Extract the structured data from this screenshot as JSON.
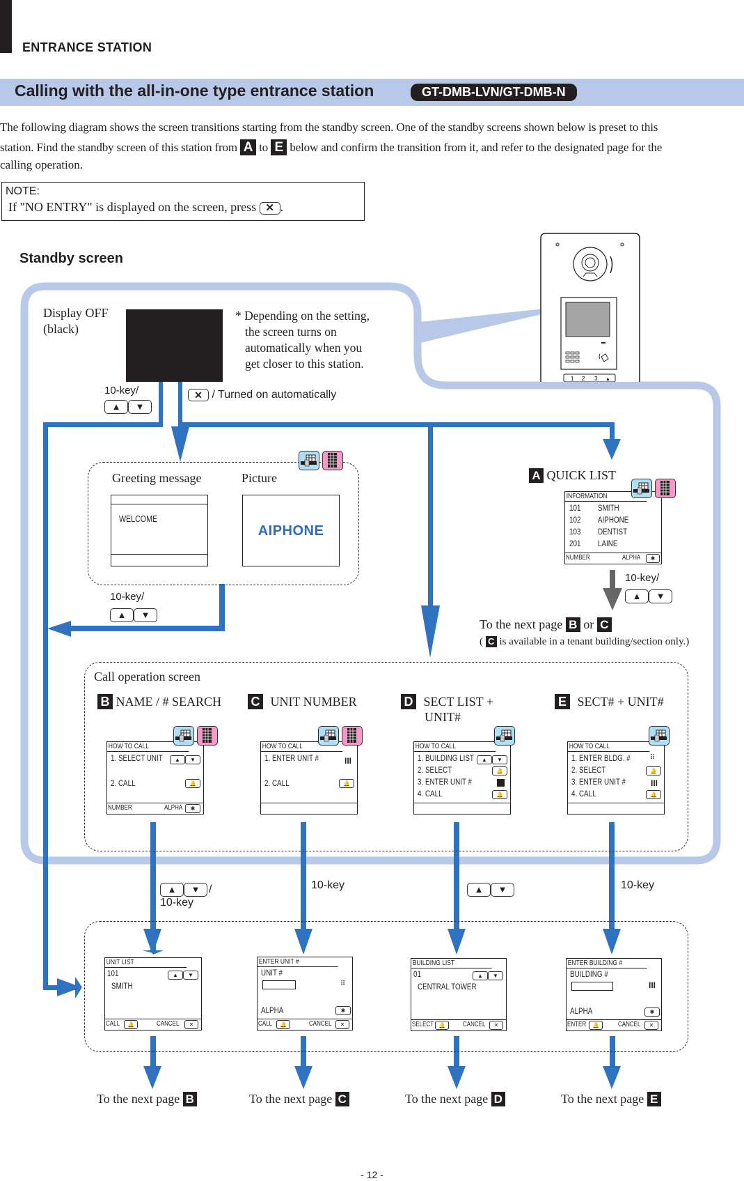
{
  "header": {
    "section": "ENTRANCE STATION",
    "title": "Calling with the all-in-one type entrance station",
    "model_badge": "GT-DMB-LVN/GT-DMB-N"
  },
  "intro": {
    "line1": "The following diagram shows the screen transitions starting from the standby screen. One of the standby screens shown below is preset to this",
    "line2_a": "station. Find the standby screen of this station from",
    "line2_b": "to",
    "line2_c": "below and confirm the transition from it, and refer to the designated page for the",
    "line3": "calling operation.",
    "from_label": "A",
    "to_label": "E"
  },
  "note": {
    "heading": "NOTE:",
    "text_a": "If \"NO ENTRY\" is displayed on the screen, press",
    "text_b": ".",
    "key_icon": "cancel-x-key"
  },
  "standby": {
    "heading": "Standby screen",
    "display_off": "Display OFF",
    "display_off_sub": "(black)",
    "asterisk_note": [
      "* Depending on the setting,",
      "the screen turns on",
      "automatically when you",
      "get closer to this station."
    ],
    "transition_left": "10-key/",
    "transition_right": "/ Turned on automatically"
  },
  "greeting_group": {
    "greeting_label": "Greeting message",
    "picture_label": "Picture",
    "welcome_text": "WELCOME",
    "logo_text": "AIPHONE",
    "transition": "10-key/"
  },
  "quick_list": {
    "label": "A",
    "title": "QUICK LIST",
    "screen_title": "INFORMATION",
    "rows": [
      {
        "num": "101",
        "name": "SMITH"
      },
      {
        "num": "102",
        "name": "AIPHONE"
      },
      {
        "num": "103",
        "name": "DENTIST"
      },
      {
        "num": "201",
        "name": "LAINE"
      }
    ],
    "footer_left": "NUMBER",
    "footer_right": "ALPHA",
    "transition": "10-key/",
    "next_a": "To the next page",
    "next_b": "or",
    "next_label1": "B",
    "next_label2": "C",
    "avail_note_a": "(",
    "avail_note_label": "C",
    "avail_note_b": "is available in a tenant building/section only.)"
  },
  "call_operation": {
    "heading": "Call operation screen",
    "modes": [
      {
        "label": "B",
        "title": "NAME / # SEARCH",
        "title2": "",
        "screen_title": "HOW TO CALL",
        "steps": [
          "1. SELECT UNIT",
          "2. CALL"
        ],
        "footer_left": "NUMBER",
        "footer_right": "ALPHA"
      },
      {
        "label": "C",
        "title": "UNIT NUMBER",
        "title2": "",
        "screen_title": "HOW TO CALL",
        "steps": [
          "1. ENTER UNIT #",
          "2. CALL"
        ]
      },
      {
        "label": "D",
        "title": "SECT LIST +",
        "title2": "UNIT#",
        "screen_title": "HOW TO CALL",
        "steps": [
          "1. BUILDING LIST",
          "2. SELECT",
          "3. ENTER UNIT #",
          "4. CALL"
        ]
      },
      {
        "label": "E",
        "title": "SECT# + UNIT#",
        "title2": "",
        "screen_title": "HOW TO CALL",
        "steps": [
          "1. ENTER BLDG. #",
          "2. SELECT",
          "3. ENTER UNIT #",
          "4. CALL"
        ]
      }
    ],
    "transitions": [
      "/",
      "10-key",
      "10-key",
      "",
      "10-key"
    ]
  },
  "second_screens": [
    {
      "title": "UNIT LIST",
      "line1": "101",
      "line2": "SMITH",
      "footer_left": "CALL",
      "footer_right": "CANCEL"
    },
    {
      "title": "ENTER UNIT #",
      "line1": "UNIT #",
      "alpha": "ALPHA",
      "footer_left": "CALL",
      "footer_right": "CANCEL"
    },
    {
      "title": "BUILDING LIST",
      "line1": "01",
      "line2": "CENTRAL TOWER",
      "footer_left": "SELECT",
      "footer_right": "CANCEL"
    },
    {
      "title": "ENTER BUILDING #",
      "line1": "BUILDING #",
      "alpha": "ALPHA",
      "footer_left": "ENTER",
      "footer_right": "CANCEL"
    }
  ],
  "next_pages": [
    {
      "text": "To the next page",
      "label": "B"
    },
    {
      "text": "To the next page",
      "label": "C"
    },
    {
      "text": "To the next page",
      "label": "D"
    },
    {
      "text": "To the next page",
      "label": "E"
    }
  ],
  "footer": {
    "page_number": "- 12 -"
  },
  "colors": {
    "accent_blue": "#2f72c0",
    "band_blue": "#b8c8e8",
    "building_icon": "#aedff5",
    "keypad_icon": "#f49ac9"
  }
}
